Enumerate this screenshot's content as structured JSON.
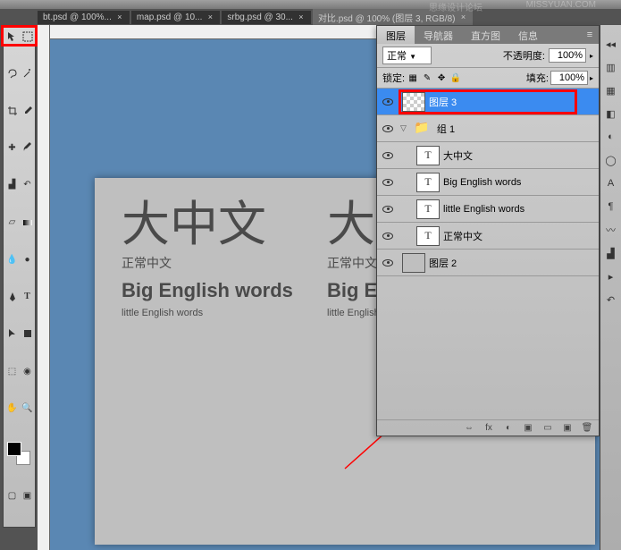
{
  "watermark1": "MISSYUAN.COM",
  "watermark2": "思缘设计论坛",
  "tabs": [
    {
      "label": "bt.psd @ 100%..."
    },
    {
      "label": "map.psd @ 10..."
    },
    {
      "label": "srbg.psd @ 30..."
    },
    {
      "label": "对比.psd @ 100% (图层 3, RGB/8)"
    }
  ],
  "canvas": {
    "big_cn": "大中文",
    "normal_cn": "正常中文",
    "big_en": "Big English words",
    "little_en": "little English words",
    "big_cn2": "大",
    "normal_cn2": "正常中文",
    "big_en2": "Big En",
    "little_en2": "little English w"
  },
  "panel": {
    "tabs": [
      "图层",
      "导航器",
      "直方图",
      "信息"
    ],
    "blend_mode": "正常",
    "opacity_label": "不透明度:",
    "opacity_value": "100%",
    "lock_label": "锁定:",
    "fill_label": "填充:",
    "fill_value": "100%"
  },
  "layers": [
    {
      "name": "图层 3",
      "type": "checker",
      "selected": true
    },
    {
      "name": "组 1",
      "type": "folder",
      "group": true
    },
    {
      "name": "大中文",
      "type": "text",
      "indent": true
    },
    {
      "name": "Big English words",
      "type": "text",
      "indent": true
    },
    {
      "name": "little English words",
      "type": "text",
      "indent": true
    },
    {
      "name": "正常中文",
      "type": "text",
      "indent": true
    },
    {
      "name": "图层 2",
      "type": "solid"
    }
  ],
  "footer_icons": [
    "⇔",
    "fx",
    "◐",
    "▣",
    "▭",
    "▣",
    "🗑"
  ]
}
